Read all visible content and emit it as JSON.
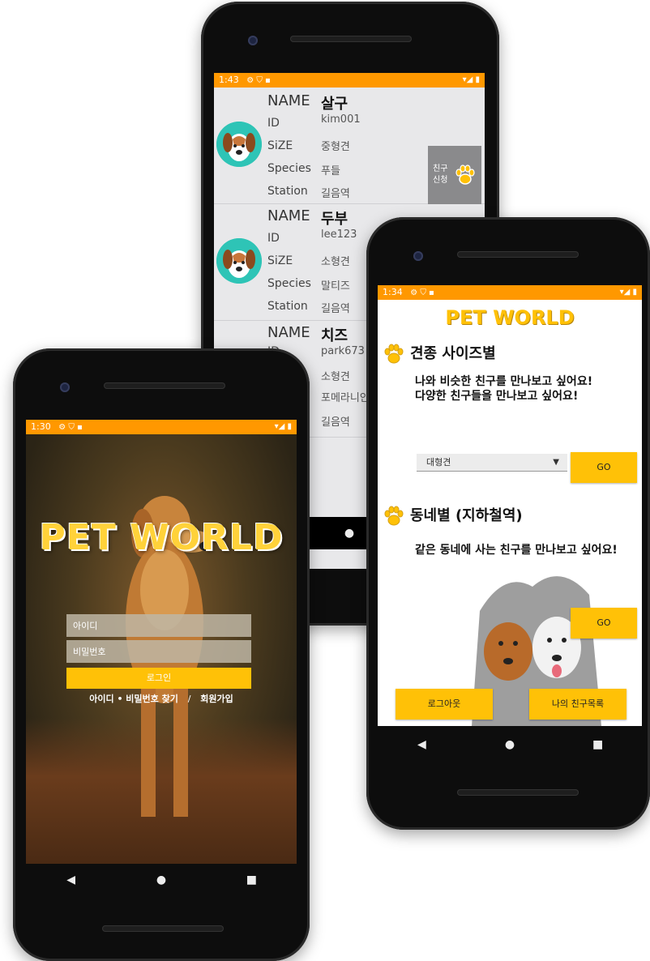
{
  "list_screen": {
    "status": {
      "time": "1:43",
      "icons": "⚙ ⛉ ▪",
      "right": "▾◢ ▮"
    },
    "field_labels": {
      "name": "NAME",
      "id": "ID",
      "size": "SiZE",
      "species": "Species",
      "station": "Station"
    },
    "friends": [
      {
        "name": "살구",
        "id": "kim001",
        "size": "중형견",
        "species": "푸들",
        "station": "길음역"
      },
      {
        "name": "두부",
        "id": "lee123",
        "size": "소형견",
        "species": "말티즈",
        "station": "길음역"
      },
      {
        "name": "치즈",
        "id": "park673",
        "size": "소형견",
        "species": "포메라니안",
        "station": "길음역"
      }
    ],
    "friend_request": {
      "line1": "친구",
      "line2": "신청"
    },
    "nav": {
      "back": "◀",
      "home": "●",
      "recent": "■"
    }
  },
  "login_screen": {
    "status": {
      "time": "1:30",
      "icons": "⚙ ⛉ ▪",
      "right": "▾◢ ▮"
    },
    "logo": "PET WORLD",
    "id_placeholder": "아이디",
    "password_placeholder": "비밀번호",
    "login_button": "로그인",
    "find_link": "아이디 • 비밀번호 찾기",
    "separator": "/",
    "signup_link": "회원가입",
    "nav": {
      "back": "◀",
      "home": "●",
      "recent": "■"
    }
  },
  "menu_screen": {
    "status": {
      "time": "1:34",
      "icons": "⚙ ⛉ ▪",
      "right": "▾◢ ▮"
    },
    "title": "PET WORLD",
    "size_section": {
      "heading": "견종 사이즈별",
      "desc1": "나와 비슷한 친구를 만나보고 싶어요!",
      "desc2": "다양한 친구들을 만나보고 싶어요!",
      "spinner_value": "대형견",
      "go_label": "GO"
    },
    "area_section": {
      "heading": "동네별 (지하철역)",
      "desc": "같은 동네에 사는 친구를 만나보고 싶어요!",
      "go_label": "GO"
    },
    "logout_label": "로그아웃",
    "friend_list_label": "나의 친구목록",
    "nav": {
      "back": "◀",
      "home": "●",
      "recent": "■"
    }
  },
  "colors": {
    "accent_orange": "#ff9800",
    "button_yellow": "#ffc107",
    "avatar_teal": "#2ec4b6"
  }
}
